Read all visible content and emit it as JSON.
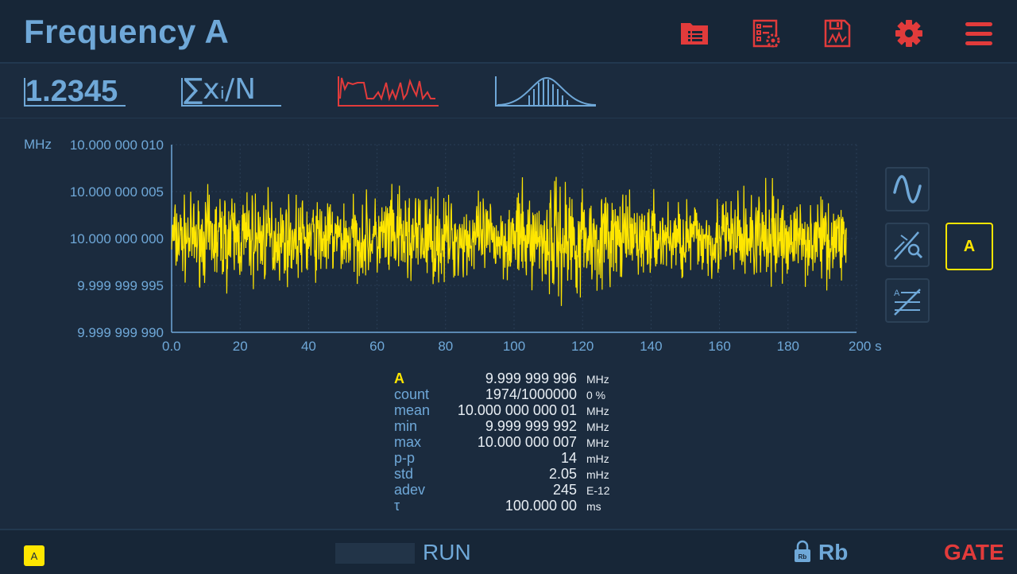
{
  "header": {
    "title": "Frequency A",
    "icons": [
      "folder-list-icon",
      "settings-list-icon",
      "save-data-icon",
      "gear-icon",
      "hamburger-menu-icon"
    ],
    "accent": "#e23b3b"
  },
  "modes": {
    "value_label": "1.2345",
    "stats_label": "∑xᵢ/N",
    "stats_sub": "i",
    "icons": [
      "timeline-mode-icon",
      "histogram-mode-icon"
    ]
  },
  "chart_data": {
    "type": "line",
    "title": "",
    "xlabel": "",
    "ylabel": "",
    "x_unit": "s",
    "y_unit": "MHz",
    "xlim": [
      0,
      200
    ],
    "ylim": [
      9.99999999,
      10.00000001
    ],
    "x_ticks": [
      "0.0",
      "20",
      "40",
      "60",
      "80",
      "100",
      "120",
      "140",
      "160",
      "180",
      "200 s"
    ],
    "y_ticks": [
      "10.000 000 010",
      "10.000 000 005",
      "10.000 000 000",
      "9.999 999 995",
      "9.999 999 990"
    ],
    "y_unit_label": "MHz",
    "grid": true,
    "series_color": "#ffe600",
    "series": [
      {
        "x": [
          0,
          10,
          20,
          30,
          40,
          50,
          60,
          70,
          80,
          90,
          100,
          110,
          120,
          130,
          140,
          150,
          160,
          170,
          180,
          190,
          197
        ],
        "values": [
          10.000000004,
          9.999999995,
          10.000000005,
          9.999999996,
          10.000000004,
          9.999999996,
          10.000000005,
          9.999999995,
          10.000000004,
          9.999999996,
          10.000000005,
          9.999999993,
          10.000000005,
          9.999999996,
          10.000000004,
          9.999999996,
          10.000000005,
          9.999999995,
          10.000000004,
          9.999999996,
          10.000000001
        ]
      }
    ]
  },
  "side_buttons": {
    "icons": [
      "sine-wave-icon",
      "magic-zoom-icon",
      "auto-scale-icon"
    ],
    "channel": "A"
  },
  "stats": {
    "channel": "A",
    "current_value": "9.999 999 996",
    "current_unit": "MHz",
    "rows": [
      {
        "label": "count",
        "value": "1974/1000000",
        "unit": "0 %"
      },
      {
        "label": "mean",
        "value": "10.000 000 000 01",
        "unit": "MHz"
      },
      {
        "label": "min",
        "value": "9.999 999 992",
        "unit": "MHz"
      },
      {
        "label": "max",
        "value": "10.000 000 007",
        "unit": "MHz"
      },
      {
        "label": "p-p",
        "value": "14",
        "unit": "mHz"
      },
      {
        "label": "std",
        "value": "2.05",
        "unit": "mHz"
      },
      {
        "label": "adev",
        "value": "245",
        "unit": "E-12"
      },
      {
        "label": "τ",
        "value": "100.000 00",
        "unit": "ms"
      }
    ]
  },
  "footer": {
    "channel_badge": "A",
    "run_label": "RUN",
    "reference_label": "Rb",
    "lock_icon_label": "Rb",
    "gate_label": "GATE"
  }
}
